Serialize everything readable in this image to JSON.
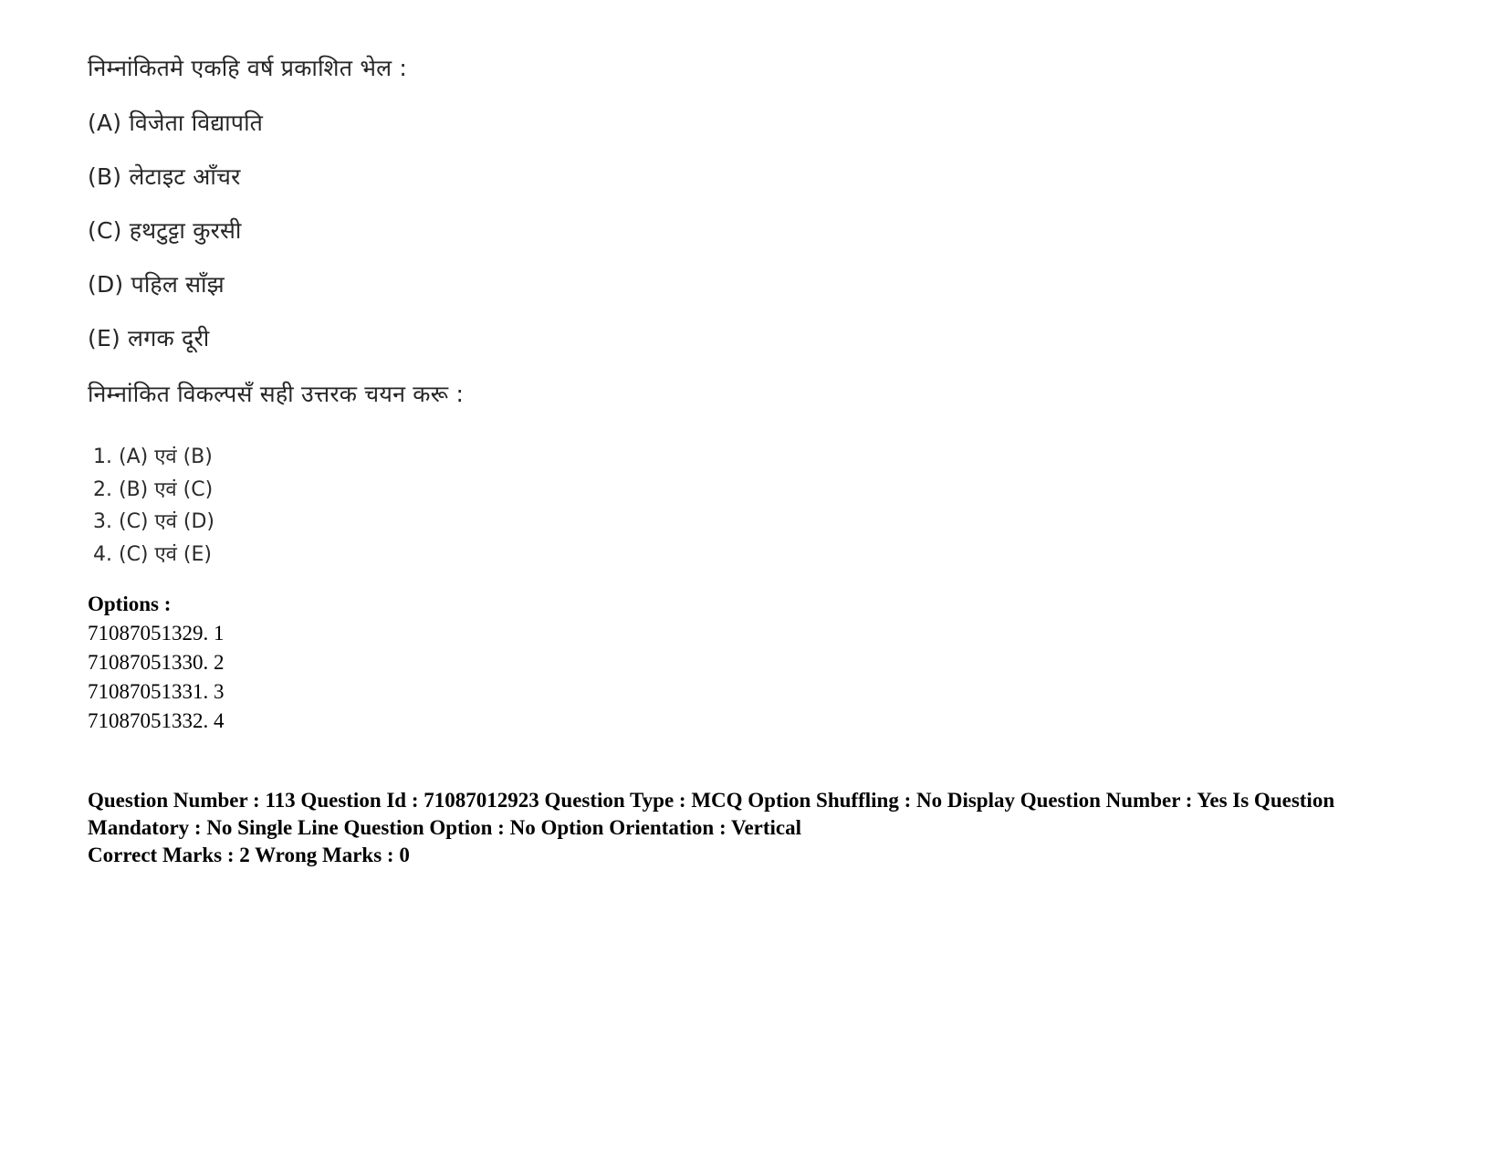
{
  "question": {
    "stem": "निम्नांकितमे एकहि वर्ष प्रकाशित भेल :",
    "statements": [
      "(A) विजेता विद्यापति",
      "(B) लेटाइट आँचर",
      "(C) हथटुट्टा कुरसी",
      "(D) पहिल साँझ",
      "(E) लगक दूरी"
    ],
    "instruction": "निम्नांकित विकल्पसँ सही उत्तरक चयन करू :",
    "choices": [
      "1. (A) एवं (B)",
      "2. (B) एवं (C)",
      "3. (C) एवं (D)",
      "4. (C) एवं (E)"
    ]
  },
  "options": {
    "heading": "Options :",
    "items": [
      "71087051329. 1",
      "71087051330. 2",
      "71087051331. 3",
      "71087051332. 4"
    ]
  },
  "meta": {
    "line1": "Question Number : 113 Question Id : 71087012923 Question Type : MCQ Option Shuffling : No Display Question Number : Yes Is Question Mandatory : No Single Line Question Option : No Option Orientation : Vertical",
    "line2": "Correct Marks : 2 Wrong Marks : 0"
  },
  "colors": {
    "background": "#ffffff",
    "text": "#000000",
    "scanned_text": "#262626"
  }
}
